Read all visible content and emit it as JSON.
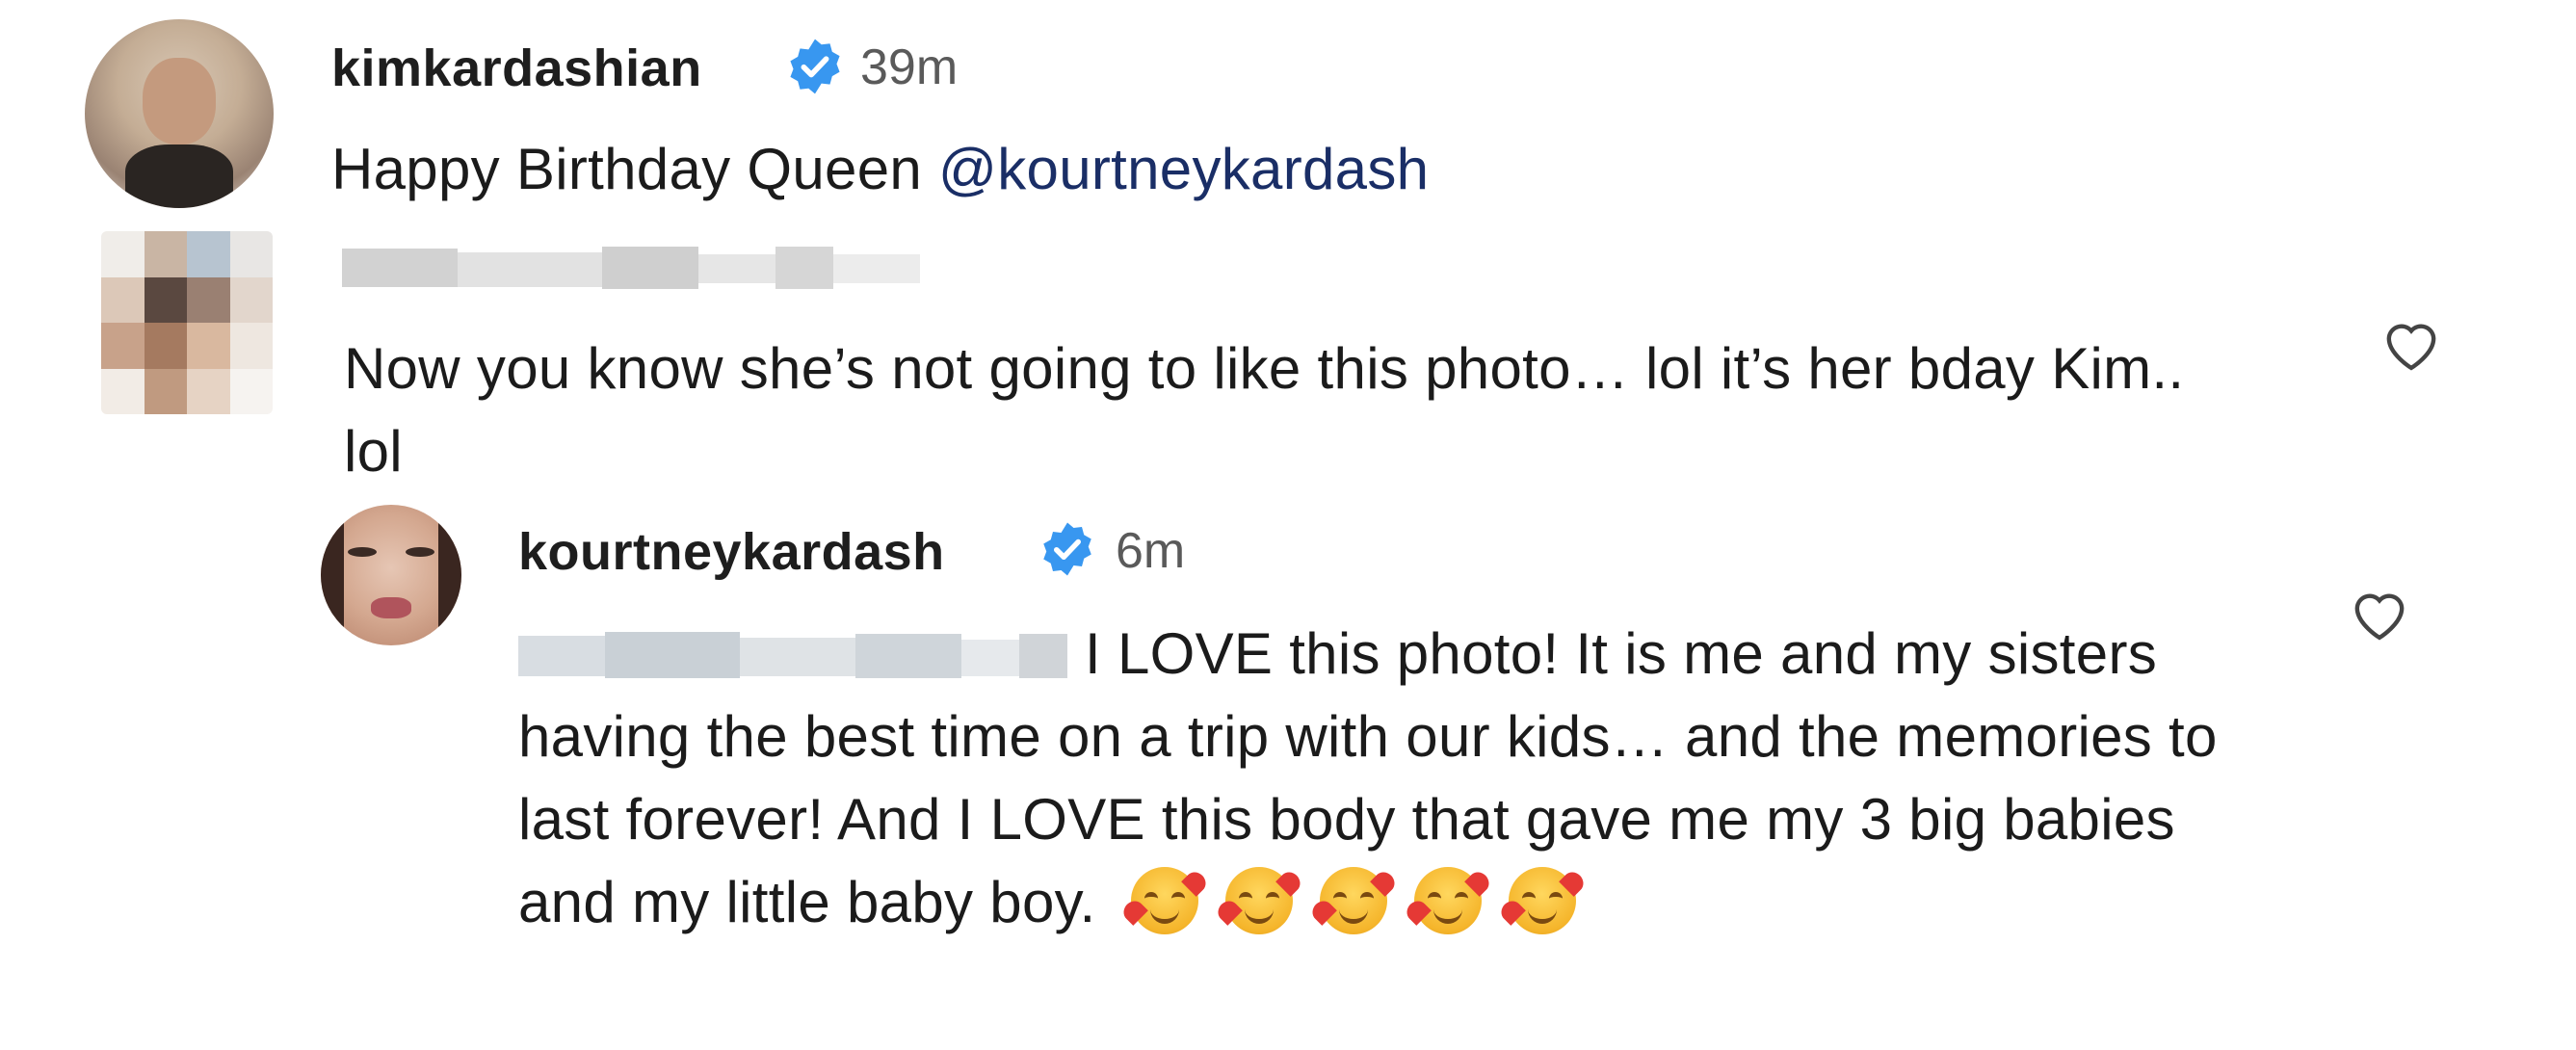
{
  "comment1": {
    "username": "kimkardashian",
    "time": "39m",
    "text_prefix": "Happy Birthday Queen ",
    "mention": "@kourtneykardash"
  },
  "comment2": {
    "text": "Now you know she’s not going to like this photo… lol it’s her bday Kim.. lol"
  },
  "reply": {
    "username": "kourtneykardash",
    "time": "6m",
    "text": "I LOVE this photo! It is me and my sisters having the best time on a trip with our kids… and the memories to last forever! And I LOVE this body that gave me my 3 big babies and my little baby boy.",
    "emoji_count": 5
  },
  "icons": {
    "verified": "verified-badge-icon",
    "heart": "heart-outline-icon"
  },
  "colors": {
    "verified": "#3897f0",
    "mention": "#1a2e66",
    "text": "#1b1b1b"
  }
}
